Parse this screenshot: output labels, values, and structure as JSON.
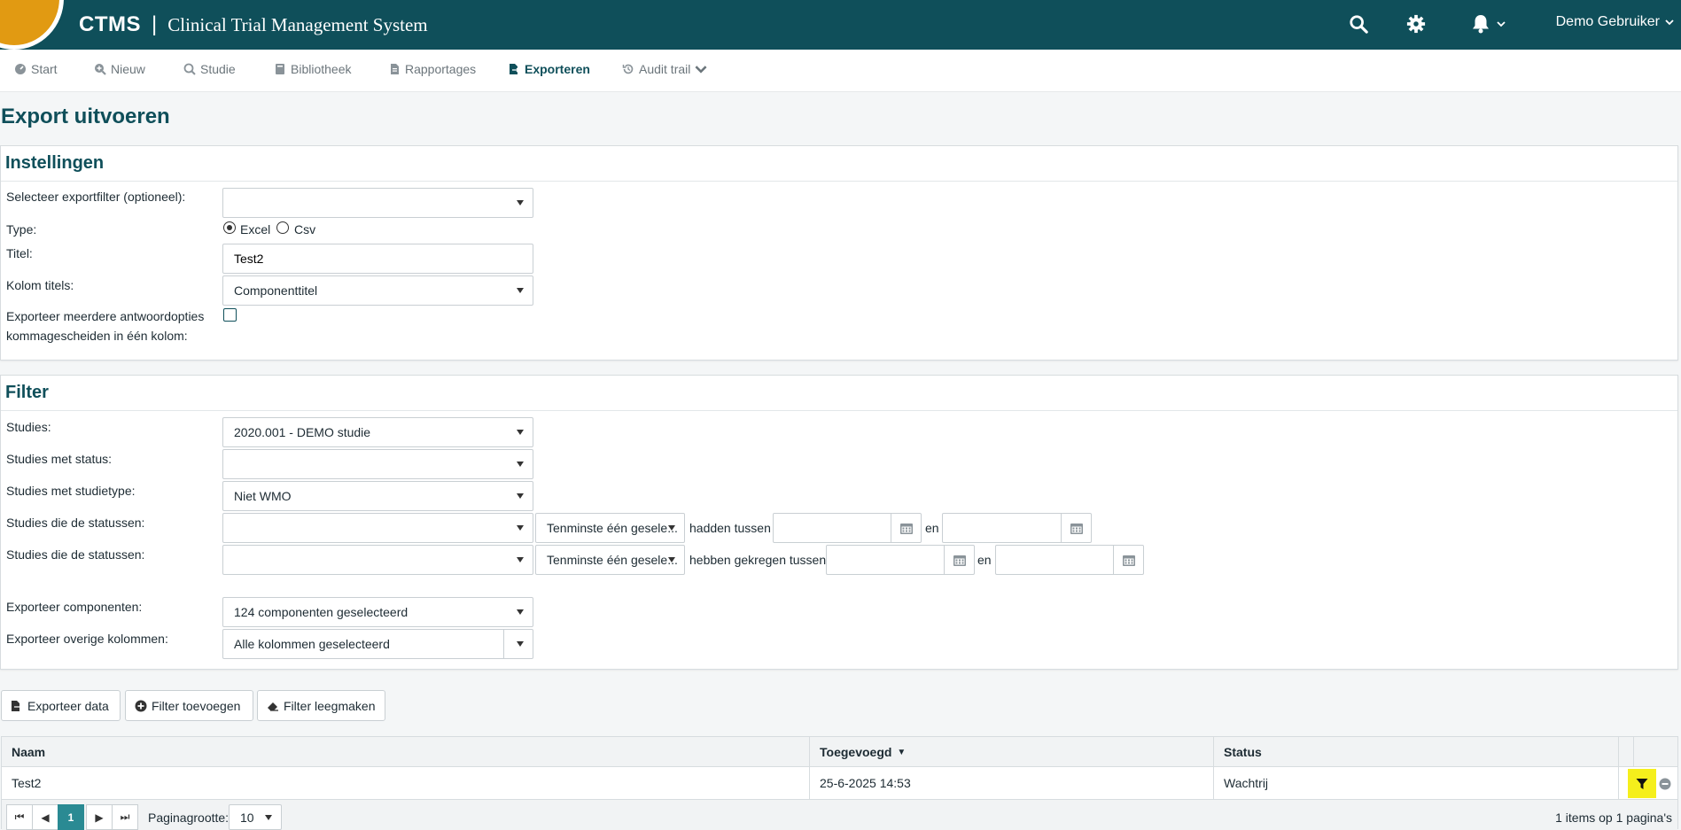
{
  "header": {
    "brand": "CTMS",
    "separator": "|",
    "subtitle": "Clinical Trial Management System",
    "user_name": "Demo Gebruiker",
    "icons": [
      "search-icon",
      "gear-icon",
      "bell-icon"
    ]
  },
  "nav": {
    "items": [
      {
        "label": "Start",
        "icon": "dashboard-icon"
      },
      {
        "label": "Nieuw",
        "icon": "search-plus-icon"
      },
      {
        "label": "Studie",
        "icon": "search-icon"
      },
      {
        "label": "Bibliotheek",
        "icon": "book-icon"
      },
      {
        "label": "Rapportages",
        "icon": "file-icon"
      },
      {
        "label": "Exporteren",
        "icon": "file-export-icon"
      },
      {
        "label": "Audit trail",
        "icon": "history-icon"
      }
    ]
  },
  "page": {
    "title": "Export uitvoeren"
  },
  "settings": {
    "heading": "Instellingen",
    "export_filter_label": "Selecteer exportfilter (optioneel):",
    "export_filter_value": "",
    "type_label": "Type:",
    "type_options": [
      "Excel",
      "Csv"
    ],
    "type_selected": "Excel",
    "title_label": "Titel:",
    "title_value": "Test2",
    "column_titles_label": "Kolom titels:",
    "column_titles_value": "Componenttitel",
    "multi_answer_label_1": "Exporteer meerdere antwoordopties",
    "multi_answer_label_2": "kommagescheiden in één kolom:",
    "multi_answer_checked": false
  },
  "filter": {
    "heading": "Filter",
    "studies_label": "Studies:",
    "studies_value": "2020.001 - DEMO studie",
    "status_label": "Studies met status:",
    "status_value": "",
    "studytype_label": "Studies met studietype:",
    "studytype_value": "Niet WMO",
    "statuses1_label": "Studies die de statussen:",
    "statuses1_value": "",
    "statuses1_mode": "Tenminste één gesele...",
    "statuses1_between": "hadden tussen",
    "statuses1_and": "en",
    "statuses2_label": "Studies die de statussen:",
    "statuses2_value": "",
    "statuses2_mode": "Tenminste één gesele...",
    "statuses2_between": "hebben gekregen tussen",
    "statuses2_and": "en",
    "components_label": "Exporteer componenten:",
    "components_value": "124 componenten geselecteerd",
    "other_columns_label": "Exporteer overige kolommen:",
    "other_columns_value": "Alle kolommen geselecteerd"
  },
  "actions": {
    "export_data": "Exporteer data",
    "add_filter": "Filter toevoegen",
    "clear_filter": "Filter leegmaken"
  },
  "grid": {
    "columns": [
      "Naam",
      "Toegevoegd",
      "Status"
    ],
    "sort_indicator": "▼",
    "rows": [
      {
        "naam": "Test2",
        "toegevoegd": "25-6-2025 14:53",
        "status": "Wachtrij"
      }
    ],
    "highlight_color": "#f5ef1c"
  },
  "pager": {
    "first": "⏮",
    "prev": "◀",
    "current": "1",
    "next": "▶",
    "last": "⏭",
    "pagesize_label": "Paginagrootte:",
    "pagesize_value": "10",
    "summary": "1 items op 1 pagina's"
  },
  "colors": {
    "brand": "#0f4f5a",
    "accent": "#e19a12",
    "active_page": "#2a8a93"
  }
}
